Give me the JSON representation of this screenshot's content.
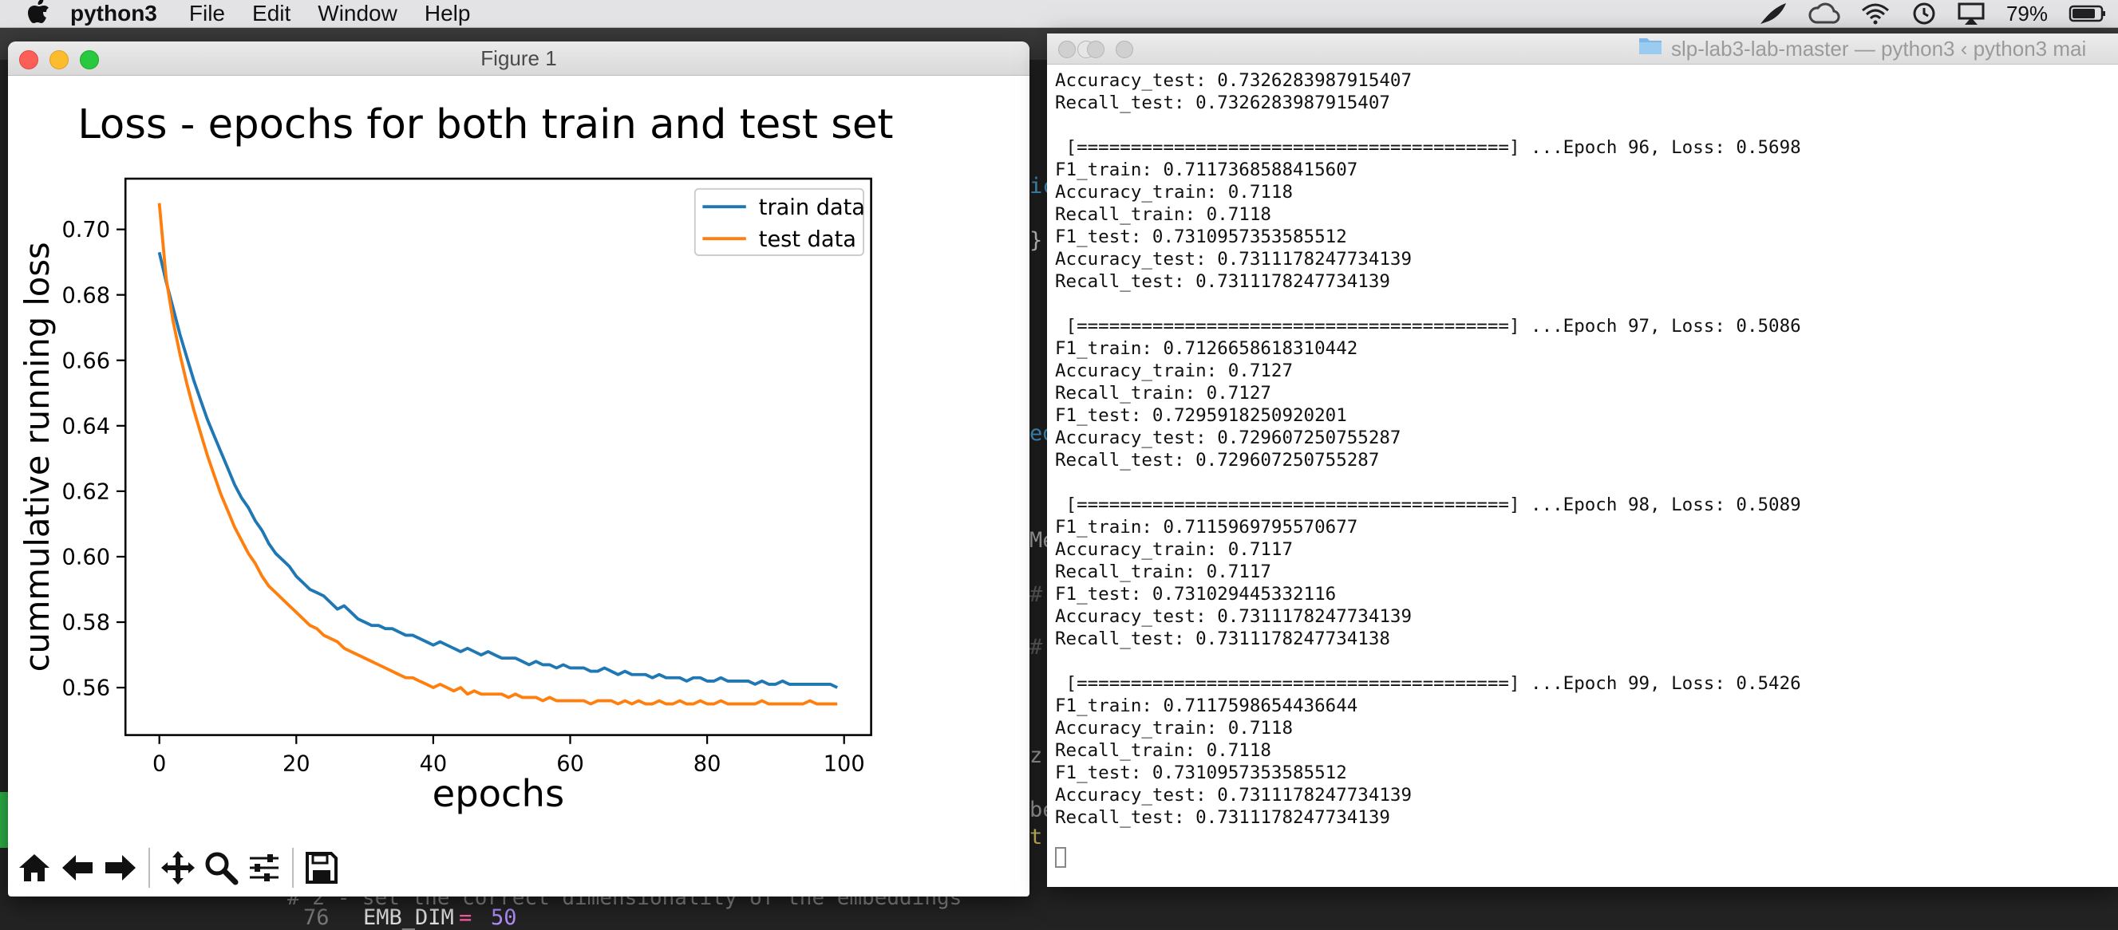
{
  "menubar": {
    "app_name": "python3",
    "menus": [
      "File",
      "Edit",
      "Window",
      "Help"
    ],
    "battery_percent": "79%",
    "status_icons": [
      "feather-icon",
      "creative-cloud-icon",
      "wifi-icon",
      "time-machine-icon",
      "airplay-icon",
      "battery-icon"
    ]
  },
  "background_editor": {
    "line_number": "76",
    "code_name": "EMB_DIM",
    "code_op": "=",
    "code_value": "50",
    "ghost_comment": "# 2 - set the correct dimensionality of the embeddings",
    "ghost_fragments": [
      "ic",
      "}",
      "ed",
      "Me",
      "#",
      "#",
      "z:",
      "be",
      "t'"
    ]
  },
  "figure_window": {
    "title": "Figure 1",
    "toolbar": [
      "home-icon",
      "back-icon",
      "forward-icon",
      "pan-icon",
      "zoom-icon",
      "configure-subplots-icon",
      "save-icon"
    ]
  },
  "chart_data": {
    "type": "line",
    "title": "Loss - epochs for both train and test set",
    "xlabel": "epochs",
    "ylabel": "cummulative running loss",
    "xlim": [
      -4.95,
      103.95
    ],
    "ylim": [
      0.5455,
      0.7155
    ],
    "xticks": [
      0,
      20,
      40,
      60,
      80,
      100
    ],
    "yticks": [
      0.56,
      0.58,
      0.6,
      0.62,
      0.64,
      0.66,
      0.68,
      0.7
    ],
    "grid": false,
    "legend_position": "upper right",
    "colors": {
      "train": "#1f77b4",
      "test": "#ff7f0e"
    },
    "series": [
      {
        "name": "train data",
        "color": "#1f77b4",
        "values": [
          0.693,
          0.684,
          0.676,
          0.668,
          0.661,
          0.654,
          0.648,
          0.642,
          0.637,
          0.632,
          0.627,
          0.622,
          0.618,
          0.615,
          0.611,
          0.608,
          0.604,
          0.601,
          0.599,
          0.597,
          0.594,
          0.592,
          0.59,
          0.589,
          0.588,
          0.586,
          0.584,
          0.585,
          0.583,
          0.581,
          0.58,
          0.579,
          0.579,
          0.578,
          0.578,
          0.577,
          0.576,
          0.576,
          0.575,
          0.574,
          0.573,
          0.574,
          0.573,
          0.572,
          0.571,
          0.572,
          0.571,
          0.57,
          0.571,
          0.57,
          0.569,
          0.569,
          0.569,
          0.568,
          0.567,
          0.568,
          0.567,
          0.567,
          0.566,
          0.567,
          0.566,
          0.566,
          0.566,
          0.565,
          0.565,
          0.566,
          0.565,
          0.564,
          0.565,
          0.564,
          0.564,
          0.564,
          0.563,
          0.564,
          0.563,
          0.563,
          0.563,
          0.562,
          0.563,
          0.563,
          0.562,
          0.562,
          0.563,
          0.562,
          0.562,
          0.562,
          0.562,
          0.561,
          0.562,
          0.561,
          0.561,
          0.562,
          0.561,
          0.561,
          0.561,
          0.561,
          0.561,
          0.561,
          0.561,
          0.56
        ]
      },
      {
        "name": "test data",
        "color": "#ff7f0e",
        "values": [
          0.708,
          0.685,
          0.672,
          0.662,
          0.653,
          0.645,
          0.638,
          0.631,
          0.625,
          0.619,
          0.614,
          0.609,
          0.605,
          0.601,
          0.598,
          0.594,
          0.591,
          0.589,
          0.587,
          0.585,
          0.583,
          0.581,
          0.579,
          0.578,
          0.576,
          0.575,
          0.574,
          0.572,
          0.571,
          0.57,
          0.569,
          0.568,
          0.567,
          0.566,
          0.565,
          0.564,
          0.563,
          0.563,
          0.562,
          0.561,
          0.56,
          0.561,
          0.56,
          0.559,
          0.56,
          0.558,
          0.559,
          0.558,
          0.558,
          0.558,
          0.558,
          0.557,
          0.558,
          0.557,
          0.557,
          0.557,
          0.556,
          0.557,
          0.556,
          0.556,
          0.556,
          0.556,
          0.556,
          0.555,
          0.556,
          0.556,
          0.556,
          0.555,
          0.556,
          0.555,
          0.556,
          0.555,
          0.555,
          0.556,
          0.555,
          0.555,
          0.556,
          0.555,
          0.555,
          0.556,
          0.555,
          0.555,
          0.556,
          0.555,
          0.555,
          0.555,
          0.555,
          0.555,
          0.556,
          0.555,
          0.555,
          0.555,
          0.555,
          0.555,
          0.555,
          0.556,
          0.555,
          0.555,
          0.555,
          0.555
        ]
      }
    ]
  },
  "terminal_window": {
    "title": "slp-lab3-lab-master — python3 ‹ python3 mai",
    "lines": [
      "Accuracy_test: 0.7326283987915407",
      "Recall_test: 0.7326283987915407",
      "",
      " [========================================] ...Epoch 96, Loss: 0.5698",
      "F1_train: 0.7117368588415607",
      "Accuracy_train: 0.7118",
      "Recall_train: 0.7118",
      "F1_test: 0.7310957353585512",
      "Accuracy_test: 0.7311178247734139",
      "Recall_test: 0.7311178247734139",
      "",
      " [========================================] ...Epoch 97, Loss: 0.5086",
      "F1_train: 0.7126658618310442",
      "Accuracy_train: 0.7127",
      "Recall_train: 0.7127",
      "F1_test: 0.7295918250920201",
      "Accuracy_test: 0.729607250755287",
      "Recall_test: 0.729607250755287",
      "",
      " [========================================] ...Epoch 98, Loss: 0.5089",
      "F1_train: 0.7115969795570677",
      "Accuracy_train: 0.7117",
      "Recall_train: 0.7117",
      "F1_test: 0.731029445332116",
      "Accuracy_test: 0.7311178247734139",
      "Recall_test: 0.7311178247734138",
      "",
      " [========================================] ...Epoch 99, Loss: 0.5426",
      "F1_train: 0.7117598654436644",
      "Accuracy_train: 0.7118",
      "Recall_train: 0.7118",
      "F1_test: 0.7310957353585512",
      "Accuracy_test: 0.7311178247734139",
      "Recall_test: 0.7311178247734139"
    ]
  }
}
